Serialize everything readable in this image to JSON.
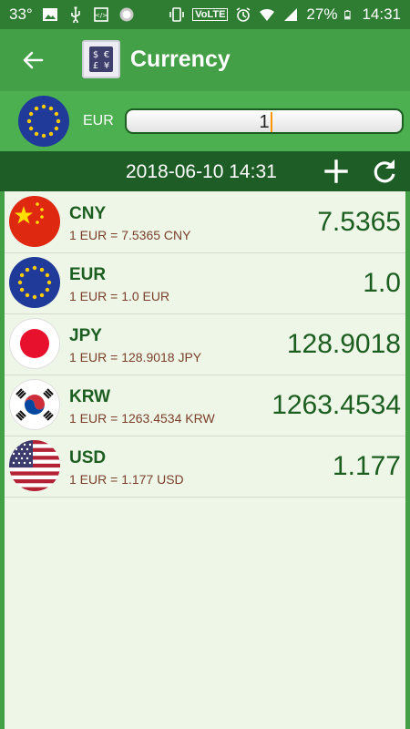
{
  "status_bar": {
    "temperature": "33°",
    "network": "VoLTE",
    "battery": "27%",
    "time": "14:31"
  },
  "toolbar": {
    "title": "Currency"
  },
  "input": {
    "currency": "EUR",
    "amount": "1"
  },
  "datebar": {
    "datetime": "2018-06-10 14:31"
  },
  "rates": [
    {
      "code": "CNY",
      "rate_text": "1 EUR = 7.5365 CNY",
      "value": "7.5365"
    },
    {
      "code": "EUR",
      "rate_text": "1 EUR = 1.0 EUR",
      "value": "1.0"
    },
    {
      "code": "JPY",
      "rate_text": "1 EUR = 128.9018 JPY",
      "value": "128.9018"
    },
    {
      "code": "KRW",
      "rate_text": "1 EUR = 1263.4534 KRW",
      "value": "1263.4534"
    },
    {
      "code": "USD",
      "rate_text": "1 EUR = 1.177 USD",
      "value": "1.177"
    }
  ],
  "colors": {
    "primary": "#43a047",
    "primary_dark": "#2e7d32",
    "datebar": "#1e5e26",
    "list_bg": "#eef6e8",
    "code_text": "#1b5e20",
    "rate_text": "#7b3f2a",
    "caret": "#ff9800"
  },
  "icons": {
    "status_left": [
      "image-icon",
      "usb-icon",
      "screen-capture-icon",
      "circle-icon"
    ],
    "status_right": [
      "vibrate-icon",
      "alarm-icon",
      "wifi-icon",
      "signal-icon",
      "battery-icon"
    ],
    "toolbar": [
      "back-arrow-icon",
      "currency-app-icon"
    ],
    "datebar": [
      "add-icon",
      "refresh-icon"
    ]
  }
}
